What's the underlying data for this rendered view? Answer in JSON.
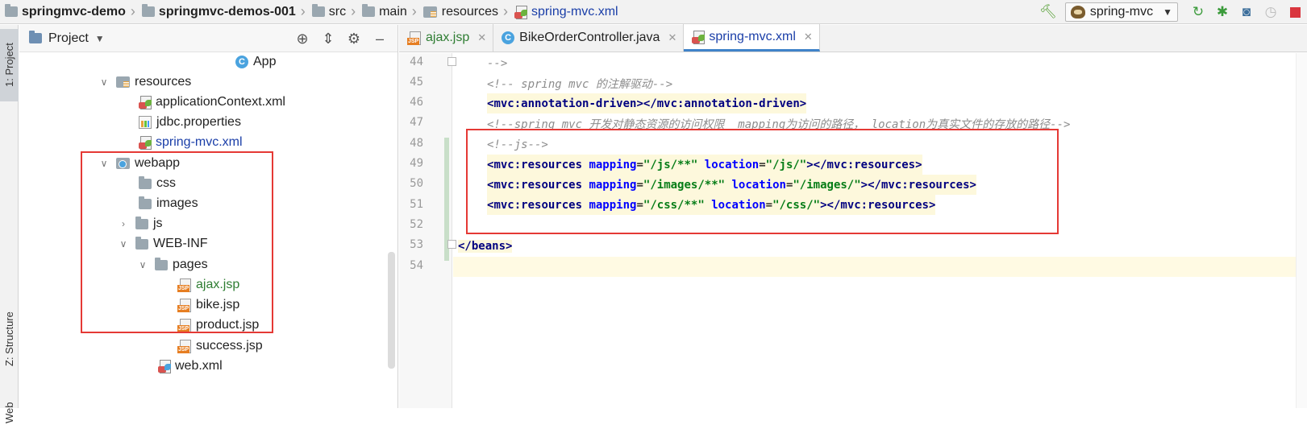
{
  "breadcrumb": {
    "items": [
      {
        "label": "springmvc-demo",
        "icon": "folder-icon",
        "bold": true
      },
      {
        "label": "springmvc-demos-001",
        "icon": "folder-icon",
        "bold": true
      },
      {
        "label": "src",
        "icon": "folder-icon"
      },
      {
        "label": "main",
        "icon": "folder-icon"
      },
      {
        "label": "resources",
        "icon": "resources-folder-icon"
      },
      {
        "label": "spring-mvc.xml",
        "icon": "spring-xml-file-icon"
      }
    ]
  },
  "toolbar": {
    "run_config": "spring-mvc",
    "icons": [
      "build-hammer-icon",
      "run-config-tomcat-icon",
      "rerun-icon",
      "debug-bug-icon",
      "coverage-icon",
      "profiler-icon",
      "stop-icon"
    ]
  },
  "left_stripe": {
    "project_tab": "1: Project",
    "structure_tab": "Z: Structure",
    "web_tab": "Web"
  },
  "project_panel": {
    "title": "Project",
    "tree": [
      {
        "label": "App",
        "icon": "class-icon"
      },
      {
        "label": "resources",
        "icon": "resources-folder-icon",
        "expanded": true
      },
      {
        "label": "applicationContext.xml",
        "icon": "spring-xml-file-icon"
      },
      {
        "label": "jdbc.properties",
        "icon": "properties-file-icon"
      },
      {
        "label": "spring-mvc.xml",
        "icon": "spring-xml-file-icon",
        "selected": true
      },
      {
        "label": "webapp",
        "icon": "web-folder-icon",
        "expanded": true
      },
      {
        "label": "css",
        "icon": "folder-icon"
      },
      {
        "label": "images",
        "icon": "folder-icon"
      },
      {
        "label": "js",
        "icon": "folder-icon",
        "expanded": false
      },
      {
        "label": "WEB-INF",
        "icon": "folder-icon",
        "expanded": true
      },
      {
        "label": "pages",
        "icon": "folder-icon",
        "expanded": true
      },
      {
        "label": "ajax.jsp",
        "icon": "jsp-file-icon",
        "color": "#2e7d32"
      },
      {
        "label": "bike.jsp",
        "icon": "jsp-file-icon"
      },
      {
        "label": "product.jsp",
        "icon": "jsp-file-icon"
      },
      {
        "label": "success.jsp",
        "icon": "jsp-file-icon"
      },
      {
        "label": "web.xml",
        "icon": "web-xml-file-icon"
      }
    ]
  },
  "editor": {
    "tabs": [
      {
        "label": "ajax.jsp",
        "icon": "jsp-file-icon",
        "color": "#2e7d32"
      },
      {
        "label": "BikeOrderController.java",
        "icon": "class-icon"
      },
      {
        "label": "spring-mvc.xml",
        "icon": "spring-xml-file-icon",
        "active": true
      }
    ],
    "line_numbers": [
      "44",
      "45",
      "46",
      "47",
      "48",
      "49",
      "50",
      "51",
      "52",
      "53",
      "54"
    ],
    "code": {
      "l44": "-->",
      "l45": "<!-- spring mvc 的注解驱动-->",
      "l46_open": "mvc:annotation-driven",
      "l46_close": "mvc:annotation-driven",
      "l47": "<!--spring mvc 开发对静态资源的访问权限  mapping为访问的路径， location为真实文件的存放的路径-->",
      "l48": "<!--js-->",
      "l49_mapping": "\"/js/**\"",
      "l49_location": "\"/js/\"",
      "l50_mapping": "\"/images/**\"",
      "l50_location": "\"/images/\"",
      "l51_mapping": "\"/css/**\"",
      "l51_location": "\"/css/\"",
      "resources_tag": "mvc:resources",
      "mapping_attr": "mapping",
      "location_attr": "location",
      "l53": "beans"
    }
  },
  "colors": {
    "annotation_box": "#e53935",
    "active_tab_underline": "#4083c9",
    "xml_tag": "#000080",
    "xml_attr": "#0000ff",
    "xml_value": "#067d17",
    "comment": "#8c8c8c"
  }
}
